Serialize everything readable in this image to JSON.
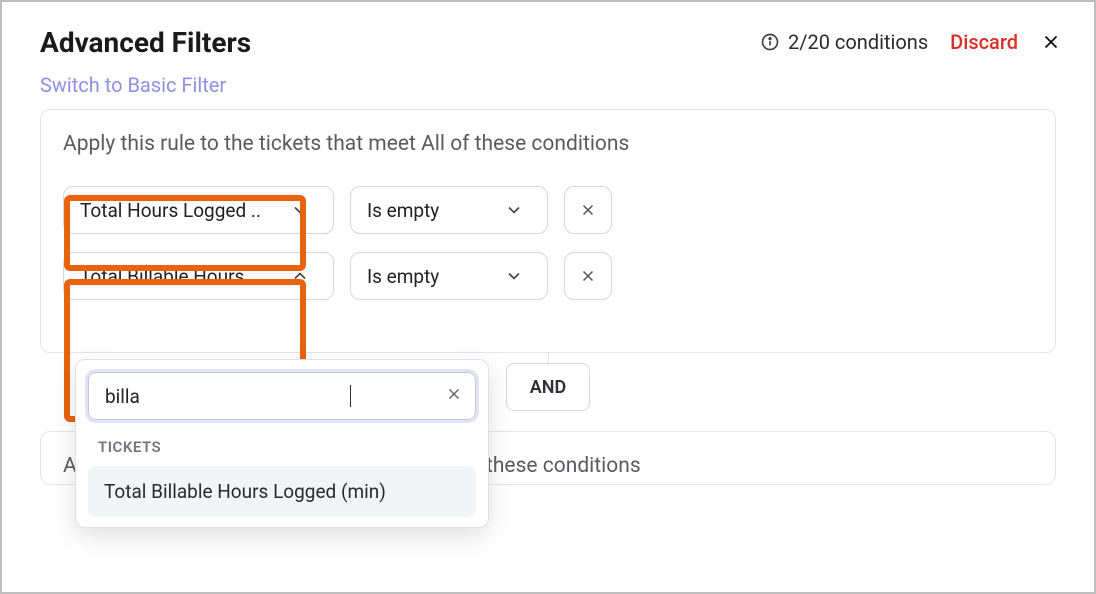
{
  "header": {
    "title": "Advanced Filters",
    "switch_link": "Switch to Basic Filter",
    "condition_count": "2/20 conditions",
    "discard_label": "Discard"
  },
  "card1": {
    "head": "Apply this rule to the tickets that meet All of these conditions",
    "row1": {
      "field": "Total Hours Logged ..",
      "operator": "Is empty"
    },
    "row2": {
      "field": "Total Billable Hours ..",
      "operator": "Is empty"
    }
  },
  "dropdown": {
    "search_value": "billa",
    "section": "TICKETS",
    "item": "Total Billable Hours Logged (min)"
  },
  "connector": {
    "label": "AND"
  },
  "card2": {
    "head": "Apply this rule to the tickets that meet Any of these conditions"
  }
}
